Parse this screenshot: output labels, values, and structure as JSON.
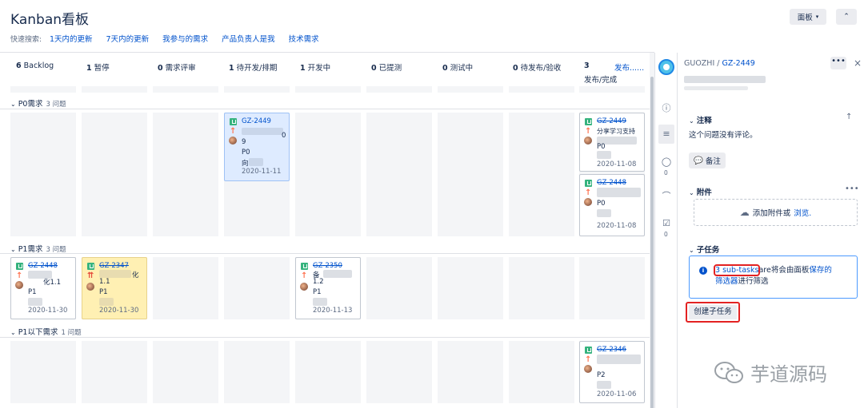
{
  "header": {
    "title": "Kanban看板",
    "quick_search_label": "快速搜索:",
    "quick_filters": [
      "1天内的更新",
      "7天内的更新",
      "我参与的需求",
      "产品负责人是我",
      "技术需求"
    ],
    "board_button": "面板",
    "collapse_button": "»"
  },
  "columns": [
    {
      "count": "6",
      "name": "Backlog"
    },
    {
      "count": "1",
      "name": "暂停"
    },
    {
      "count": "0",
      "name": "需求评审"
    },
    {
      "count": "1",
      "name": "待开发/排期"
    },
    {
      "count": "1",
      "name": "开发中"
    },
    {
      "count": "0",
      "name": "已提测"
    },
    {
      "count": "0",
      "name": "测试中"
    },
    {
      "count": "0",
      "name": "待发布/验收"
    },
    {
      "count": "3",
      "name": "发布/完成",
      "release_link": "发布......"
    }
  ],
  "swimlanes": [
    {
      "name": "P0需求",
      "count": "3 问题"
    },
    {
      "name": "P1需求",
      "count": "3 问题"
    },
    {
      "name": "P1以下需求",
      "count": "1 问题"
    }
  ],
  "cards": {
    "c1": {
      "key": "GZ-2449",
      "summary_visible": "",
      "extra": "0",
      "line9": "9",
      "priority_text": "P0",
      "owner": "向",
      "date": "2020-11-11"
    },
    "c2": {
      "key": "GZ-2449",
      "summary_visible": "分享学习支持",
      "priority_text": "P0",
      "date": "2020-11-08"
    },
    "c3": {
      "key": "GZ-2448",
      "priority_text": "P0",
      "date": "2020-11-08"
    },
    "c4": {
      "key": "GZ-2448",
      "summary_visible": "化1.1",
      "priority_text": "P1",
      "date": "2020-11-30"
    },
    "c5": {
      "key": "GZ-2347",
      "summary_visible": "化",
      "line2": "1.1",
      "priority_text": "P1",
      "date": "2020-11-30"
    },
    "c6": {
      "key": "GZ-2350",
      "summary_visible": "备",
      "line2": "1.2",
      "priority_text": "P1",
      "date": "2020-11-13"
    },
    "c7": {
      "key": "GZ-2346",
      "priority_text": "P2",
      "date": "2020-11-06"
    }
  },
  "detail": {
    "project": "GUOZHI",
    "separator": " / ",
    "issue_key": "GZ-2449",
    "more": "•••",
    "close": "×",
    "comments_title": "注释",
    "no_comments": "这个问题没有评论。",
    "note_button": "备注",
    "attachments_title": "附件",
    "attach_more": "•••",
    "drop_text": "添加附件或",
    "browse_link": "浏览.",
    "subtasks_title": "子任务",
    "subtask_link": "3 sub-tasks",
    "subtask_text1": "are将会由面板",
    "saved_filter_link1": "保存的",
    "saved_filter_link2": "筛选器",
    "subtask_text2": "进行筛选",
    "create_subtask_button": "创建子任务",
    "rail_badge_comments": "0",
    "rail_badge_checks": "0"
  },
  "watermark": {
    "text": "芋道源码"
  },
  "colors": {
    "link": "#0052cc",
    "story": "#36b37e",
    "highlight": "#e32222",
    "selected_card": "#deebff",
    "flagged_card": "#fff0b3"
  }
}
